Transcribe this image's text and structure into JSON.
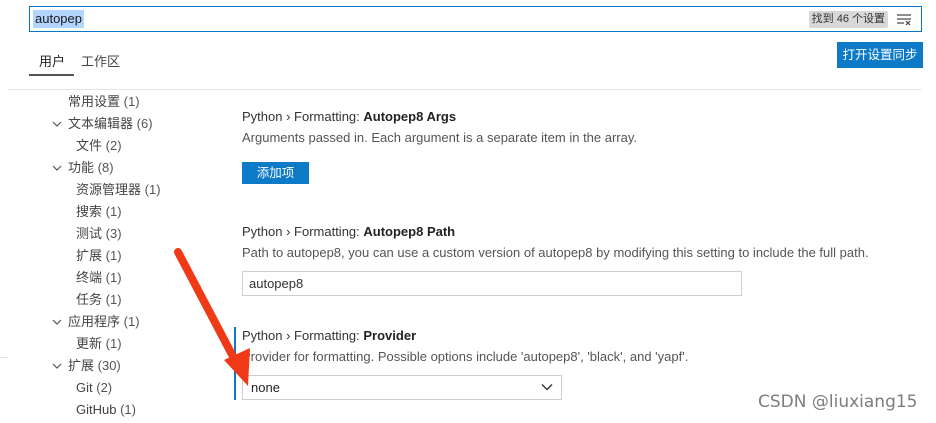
{
  "search": {
    "value": "autopep",
    "result_count": "找到 46 个设置"
  },
  "tabs": [
    {
      "label": "用户"
    },
    {
      "label": "工作区"
    }
  ],
  "sync_button": "打开设置同步",
  "toc": [
    {
      "label": "常用设置",
      "count": "(1)"
    },
    {
      "label": "文本编辑器",
      "count": "(6)"
    },
    {
      "label": "文件",
      "count": "(2)"
    },
    {
      "label": "功能",
      "count": "(8)"
    },
    {
      "label": "资源管理器",
      "count": "(1)"
    },
    {
      "label": "搜索",
      "count": "(1)"
    },
    {
      "label": "测试",
      "count": "(3)"
    },
    {
      "label": "扩展",
      "count": "(1)"
    },
    {
      "label": "终端",
      "count": "(1)"
    },
    {
      "label": "任务",
      "count": "(1)"
    },
    {
      "label": "应用程序",
      "count": "(1)"
    },
    {
      "label": "更新",
      "count": "(1)"
    },
    {
      "label": "扩展",
      "count": "(30)"
    },
    {
      "label": "Git",
      "count": "(2)"
    },
    {
      "label": "GitHub",
      "count": "(1)"
    }
  ],
  "settings": [
    {
      "prefix": "Python › Formatting: ",
      "name": "Autopep8 Args",
      "description": "Arguments passed in. Each argument is a separate item in the array.",
      "button": "添加项"
    },
    {
      "prefix": "Python › Formatting: ",
      "name": "Autopep8 Path",
      "description": "Path to autopep8, you can use a custom version of autopep8 by modifying this setting to include the full path.",
      "value": "autopep8"
    },
    {
      "prefix": "Python › Formatting: ",
      "name": "Provider",
      "description": "Provider for formatting. Possible options include 'autopep8', 'black', and 'yapf'.",
      "value": "none"
    }
  ],
  "watermark": "CSDN @liuxiang15",
  "colors": {
    "accent": "#0c7ac7",
    "annotation_arrow": "#f03a17",
    "search_highlight": "#b4d5fe"
  }
}
